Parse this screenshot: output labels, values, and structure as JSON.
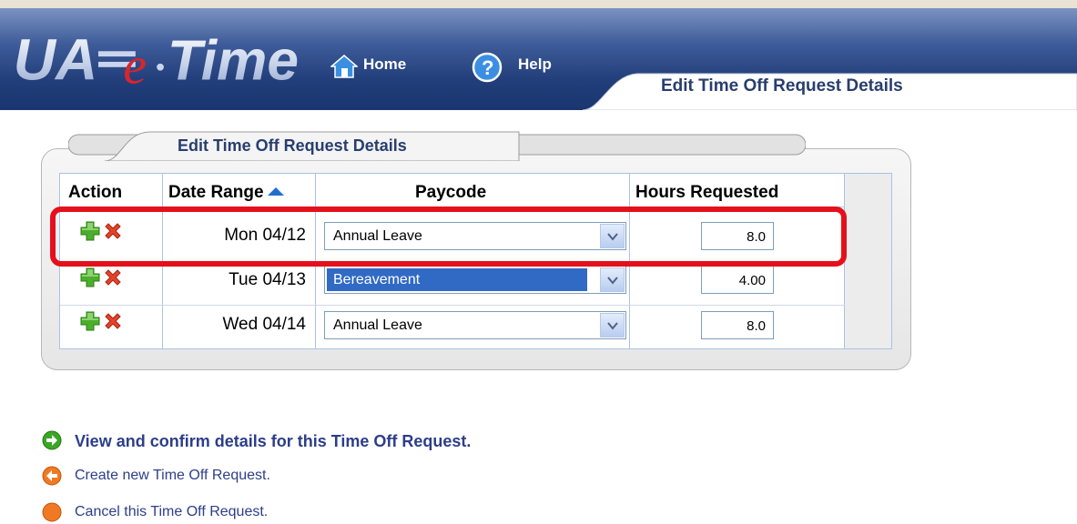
{
  "header": {
    "logo_text": "UA e-Time",
    "home_label": "Home",
    "help_label": "Help",
    "page_title": "Edit Time Off Request Details"
  },
  "panel": {
    "title": "Edit Time Off Request Details",
    "columns": [
      "Action",
      "Date Range",
      "Paycode",
      "Hours Requested"
    ],
    "sort": {
      "column": "Date Range",
      "direction": "ascending"
    },
    "rows": [
      {
        "date": "Mon 04/12",
        "paycode": "Annual Leave",
        "hours": "8.0",
        "selected": false,
        "highlighted": true
      },
      {
        "date": "Tue 04/13",
        "paycode": "Bereavement",
        "hours": "4.00",
        "selected": true,
        "highlighted": false
      },
      {
        "date": "Wed 04/14",
        "paycode": "Annual Leave",
        "hours": "8.0",
        "selected": false,
        "highlighted": false
      }
    ]
  },
  "links": [
    {
      "label": "View and confirm details for this Time Off Request.",
      "icon": "green-arrow-right-icon"
    },
    {
      "label": "Create new Time Off Request.",
      "icon": "orange-arrow-left-icon"
    },
    {
      "label": "Cancel this Time Off Request.",
      "icon": "orange-circle-icon"
    }
  ],
  "colors": {
    "header_blue": "#223f7b",
    "link_text": "#2c3e8a",
    "highlight_red": "#e4101c",
    "selection_blue": "#316ac5"
  }
}
